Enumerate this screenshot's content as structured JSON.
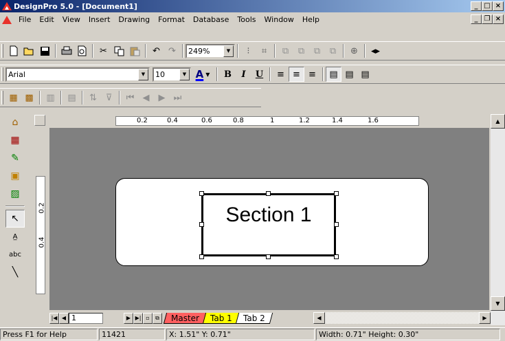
{
  "window": {
    "title": "DesignPro 5.0 - [Document1]",
    "min_glyph": "_",
    "max_glyph": "□",
    "close_glyph": "×"
  },
  "menu": {
    "items": [
      "File",
      "Edit",
      "View",
      "Insert",
      "Drawing",
      "Format",
      "Database",
      "Tools",
      "Window",
      "Help"
    ],
    "doc_min": "_",
    "doc_restore": "❐",
    "doc_close": "×"
  },
  "toolbar_standard": {
    "zoom_value": "249%"
  },
  "toolbar_format": {
    "font_name": "Arial",
    "font_size": "10",
    "font_color_label": "A",
    "bold": "B",
    "italic": "I",
    "underline": "U"
  },
  "ruler": {
    "h_labels": [
      "0.2",
      "0.4",
      "0.6",
      "0.8",
      "1",
      "1.2",
      "1.4",
      "1.6"
    ],
    "v_labels": [
      "0.2",
      "0.4"
    ]
  },
  "canvas": {
    "text_frame_content": "Section 1"
  },
  "tabs": {
    "page_number": "1",
    "items": [
      {
        "label": "Master",
        "color": "#ff6060"
      },
      {
        "label": "Tab 1",
        "color": "#ffff00"
      },
      {
        "label": "Tab 2",
        "color": "#ffffff"
      }
    ]
  },
  "status": {
    "help": "Press F1 for Help",
    "count": "11421",
    "coords": "X: 1.51\"  Y: 0.71\"",
    "size": "Width: 0.71\"  Height: 0.30\""
  }
}
